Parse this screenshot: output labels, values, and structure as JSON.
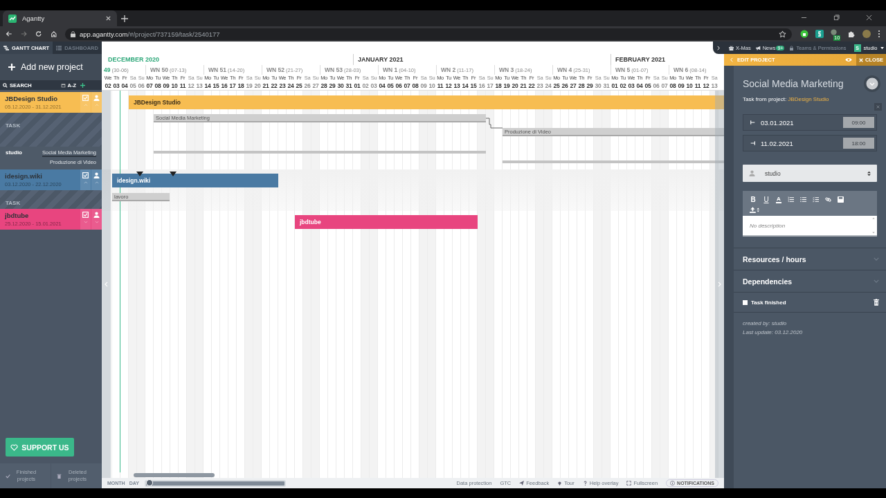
{
  "browser": {
    "tab_title": "Agantty",
    "url_host": "app.agantty.com",
    "url_path": "/#/project/737159/task/2540177",
    "extension_badge": "10"
  },
  "nav_tabs": [
    {
      "label": "GANTT CHART",
      "selected": true
    },
    {
      "label": "DASHBOARD",
      "selected": false
    }
  ],
  "add_project": "Add new project",
  "search": {
    "label": "SEARCH",
    "sort": "A-Z"
  },
  "projects": [
    {
      "name": "JBDesign Studio",
      "dates": "05.12.2020 - 31.12.2021",
      "color": "#f7bd52",
      "expanded": true,
      "task_label": "TASK",
      "resources": [
        {
          "name": "studio",
          "tasks": [
            "Social Media Marketing",
            "Produzione di Video"
          ]
        }
      ]
    },
    {
      "name": "idesign.wiki",
      "dates": "03.12.2020 - 22.12.2020",
      "color": "#4a7aa3",
      "expanded": true,
      "task_label": "TASK"
    },
    {
      "name": "jbdtube",
      "dates": "25.12.2020 - 15.01.2021",
      "color": "#e8457f",
      "expanded": false
    }
  ],
  "support": "SUPPORT US",
  "footer_items": [
    "Finished projects",
    "Deleted projects"
  ],
  "timeline": {
    "months": [
      {
        "label": "DECEMBER 2020",
        "current": true
      },
      {
        "label": "JANUARY 2021",
        "current": false
      },
      {
        "label": "FEBRUARY 2021",
        "current": false
      }
    ],
    "weeks": [
      {
        "label": "49",
        "range": "(30-06)",
        "current": true,
        "days": [
          {
            "name": "We",
            "num": "02",
            "weekend": false
          },
          {
            "name": "Th",
            "num": "03",
            "weekend": false
          },
          {
            "name": "Fr",
            "num": "04",
            "weekend": false
          },
          {
            "name": "Sa",
            "num": "05",
            "weekend": true
          },
          {
            "name": "Su",
            "num": "06",
            "weekend": true
          }
        ]
      },
      {
        "label": "WN 50",
        "range": "(07-13)",
        "current": false,
        "days": [
          {
            "name": "Mo",
            "num": "07",
            "weekend": false
          },
          {
            "name": "Tu",
            "num": "08",
            "weekend": false
          },
          {
            "name": "We",
            "num": "09",
            "weekend": false
          },
          {
            "name": "Th",
            "num": "10",
            "weekend": false
          },
          {
            "name": "Fr",
            "num": "11",
            "weekend": false
          },
          {
            "name": "Sa",
            "num": "12",
            "weekend": true
          },
          {
            "name": "Su",
            "num": "13",
            "weekend": true
          }
        ]
      },
      {
        "label": "WN 51",
        "range": "(14-20)",
        "current": false,
        "days": [
          {
            "name": "Mo",
            "num": "14",
            "weekend": false
          },
          {
            "name": "Tu",
            "num": "15",
            "weekend": false
          },
          {
            "name": "We",
            "num": "16",
            "weekend": false
          },
          {
            "name": "Th",
            "num": "17",
            "weekend": false
          },
          {
            "name": "Fr",
            "num": "18",
            "weekend": false
          },
          {
            "name": "Sa",
            "num": "19",
            "weekend": true
          },
          {
            "name": "Su",
            "num": "20",
            "weekend": true
          }
        ]
      },
      {
        "label": "WN 52",
        "range": "(21-27)",
        "current": false,
        "days": [
          {
            "name": "Mo",
            "num": "21",
            "weekend": false
          },
          {
            "name": "Tu",
            "num": "22",
            "weekend": false
          },
          {
            "name": "We",
            "num": "23",
            "weekend": false
          },
          {
            "name": "Th",
            "num": "24",
            "weekend": false
          },
          {
            "name": "Fr",
            "num": "25",
            "weekend": false
          },
          {
            "name": "Sa",
            "num": "26",
            "weekend": true
          },
          {
            "name": "Su",
            "num": "27",
            "weekend": true
          }
        ]
      },
      {
        "label": "WN 53",
        "range": "(28-03)",
        "current": false,
        "days": [
          {
            "name": "Mo",
            "num": "28",
            "weekend": false
          },
          {
            "name": "Tu",
            "num": "29",
            "weekend": false
          },
          {
            "name": "We",
            "num": "30",
            "weekend": false
          },
          {
            "name": "Th",
            "num": "31",
            "weekend": false
          },
          {
            "name": "Fr",
            "num": "01",
            "weekend": false
          },
          {
            "name": "Sa",
            "num": "02",
            "weekend": true
          },
          {
            "name": "Su",
            "num": "03",
            "weekend": true
          }
        ]
      },
      {
        "label": "WN 1",
        "range": "(04-10)",
        "current": false,
        "days": [
          {
            "name": "Mo",
            "num": "04",
            "weekend": false
          },
          {
            "name": "Tu",
            "num": "05",
            "weekend": false
          },
          {
            "name": "We",
            "num": "06",
            "weekend": false
          },
          {
            "name": "Th",
            "num": "07",
            "weekend": false
          },
          {
            "name": "Fr",
            "num": "08",
            "weekend": false
          },
          {
            "name": "Sa",
            "num": "09",
            "weekend": true
          },
          {
            "name": "Su",
            "num": "10",
            "weekend": true
          }
        ]
      },
      {
        "label": "WN 2",
        "range": "(11-17)",
        "current": false,
        "days": [
          {
            "name": "Mo",
            "num": "11",
            "weekend": false
          },
          {
            "name": "Tu",
            "num": "12",
            "weekend": false
          },
          {
            "name": "We",
            "num": "13",
            "weekend": false
          },
          {
            "name": "Th",
            "num": "14",
            "weekend": false
          },
          {
            "name": "Fr",
            "num": "15",
            "weekend": false
          },
          {
            "name": "Sa",
            "num": "16",
            "weekend": true
          },
          {
            "name": "Su",
            "num": "17",
            "weekend": true
          }
        ]
      },
      {
        "label": "WN 3",
        "range": "(18-24)",
        "current": false,
        "days": [
          {
            "name": "Mo",
            "num": "18",
            "weekend": false
          },
          {
            "name": "Tu",
            "num": "19",
            "weekend": false
          },
          {
            "name": "We",
            "num": "20",
            "weekend": false
          },
          {
            "name": "Th",
            "num": "21",
            "weekend": false
          },
          {
            "name": "Fr",
            "num": "22",
            "weekend": false
          },
          {
            "name": "Sa",
            "num": "23",
            "weekend": true
          },
          {
            "name": "Su",
            "num": "24",
            "weekend": true
          }
        ]
      },
      {
        "label": "WN 4",
        "range": "(25-31)",
        "current": false,
        "days": [
          {
            "name": "Mo",
            "num": "25",
            "weekend": false
          },
          {
            "name": "Tu",
            "num": "26",
            "weekend": false
          },
          {
            "name": "We",
            "num": "27",
            "weekend": false
          },
          {
            "name": "Th",
            "num": "28",
            "weekend": false
          },
          {
            "name": "Fr",
            "num": "29",
            "weekend": false
          },
          {
            "name": "Sa",
            "num": "30",
            "weekend": true
          },
          {
            "name": "Su",
            "num": "31",
            "weekend": true
          }
        ]
      },
      {
        "label": "WN 5",
        "range": "(01-07)",
        "current": false,
        "days": [
          {
            "name": "Mo",
            "num": "01",
            "weekend": false
          },
          {
            "name": "Tu",
            "num": "02",
            "weekend": false
          },
          {
            "name": "We",
            "num": "03",
            "weekend": false
          },
          {
            "name": "Th",
            "num": "04",
            "weekend": false
          },
          {
            "name": "Fr",
            "num": "05",
            "weekend": false
          },
          {
            "name": "Sa",
            "num": "06",
            "weekend": true
          },
          {
            "name": "Su",
            "num": "07",
            "weekend": true
          }
        ]
      },
      {
        "label": "WN 6",
        "range": "(08-14)",
        "current": false,
        "days": [
          {
            "name": "Mo",
            "num": "08",
            "weekend": false
          },
          {
            "name": "Tu",
            "num": "09",
            "weekend": false
          },
          {
            "name": "We",
            "num": "10",
            "weekend": false
          },
          {
            "name": "Th",
            "num": "11",
            "weekend": false
          },
          {
            "name": "Fr",
            "num": "12",
            "weekend": false
          },
          {
            "name": "Sa",
            "num": "13",
            "weekend": true
          }
        ]
      }
    ]
  },
  "bars": [
    {
      "kind": "project",
      "label": "JBDesign Studio",
      "color": "#f7bd52"
    },
    {
      "kind": "task",
      "label": "Social Media Marketing"
    },
    {
      "kind": "task",
      "label": "Produzione di Video"
    },
    {
      "kind": "resource"
    },
    {
      "kind": "resource"
    },
    {
      "kind": "project",
      "label": "idesign.wiki",
      "color": "#4a7aa3"
    },
    {
      "kind": "task",
      "label": "lavoro"
    },
    {
      "kind": "project",
      "label": "jbdtube",
      "color": "#e8457f"
    }
  ],
  "zoom": {
    "labels": [
      "MONTH",
      "DAY"
    ],
    "level": 0
  },
  "footer_links": [
    "Data protection",
    "GTC",
    "Feedback",
    "Tour",
    "Help overlay",
    "Fullscreen"
  ],
  "notifications": "NOTIFICATIONS",
  "top_links": [
    {
      "label": "X-Mas",
      "disabled": false
    },
    {
      "label": "News",
      "badge": "9+",
      "disabled": false
    },
    {
      "label": "Teams & Permissions",
      "disabled": true
    }
  ],
  "user": {
    "initial": "S",
    "name": "studio"
  },
  "panel": {
    "header": "EDIT PROJECT",
    "close": "CLOSE",
    "title": "Social Media Marketing",
    "from_label": "Task from project:",
    "from_project": "JBDesign Studio",
    "start_date": "03.01.2021",
    "start_time": "09:00",
    "end_date": "11.02.2021",
    "end_time": "18:00",
    "assignee": "studio",
    "format_buttons": [
      "B",
      "U",
      "A"
    ],
    "description_placeholder": "No description",
    "sections": [
      "Resources / hours",
      "Dependencies"
    ],
    "task_finished": {
      "label": "Task finished",
      "checked": false
    },
    "created_by": "created by: studio",
    "last_update": "Last update: 03.12.2020"
  }
}
